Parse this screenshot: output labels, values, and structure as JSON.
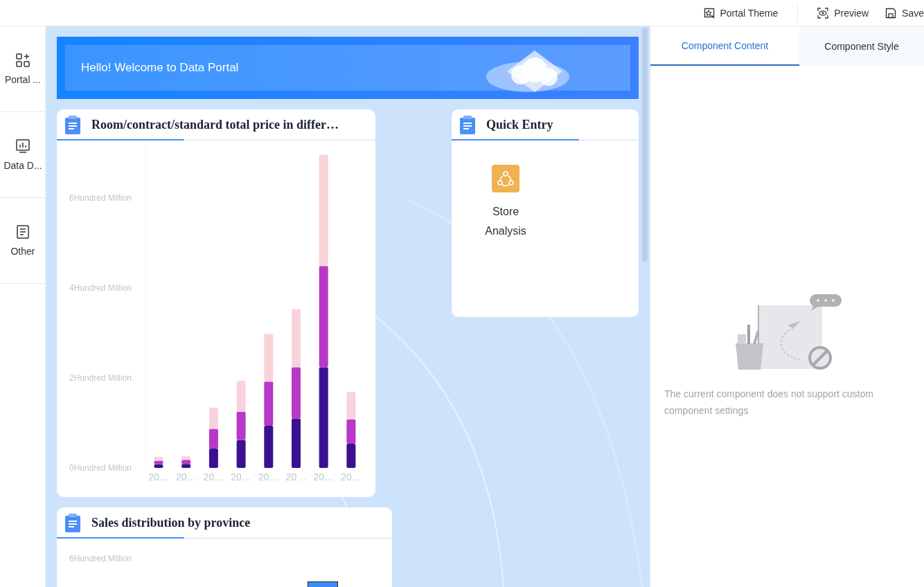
{
  "toolbar": [
    {
      "kind": "theme",
      "label": "Portal Theme",
      "separated": false
    },
    {
      "kind": "preview",
      "label": "Preview",
      "separated": true
    },
    {
      "kind": "save",
      "label": "Save",
      "separated": false
    }
  ],
  "sidebar": {
    "items": [
      {
        "kind": "components",
        "label": "Portal ..."
      },
      {
        "kind": "data",
        "label": "Data D..."
      },
      {
        "kind": "other",
        "label": "Other"
      }
    ]
  },
  "banner": {
    "text": "Hello! Welcome to Data Portal"
  },
  "price_card": {
    "title": "Room/contract/standard total price in differ…",
    "chart_data": {
      "type": "bar",
      "stacked": true,
      "categories": [
        "20…",
        "20…",
        "20…",
        "20…",
        "20…",
        "20…",
        "20…",
        "20…"
      ],
      "ylim": [
        0,
        7.2
      ],
      "yticks": [
        {
          "value": 0,
          "label": "0Hundred Million"
        },
        {
          "value": 2,
          "label": "2Hundred Million"
        },
        {
          "value": 4,
          "label": "4Hundred Million"
        },
        {
          "value": 6,
          "label": "6Hundred Million"
        }
      ],
      "series": [
        {
          "color": "#3b1191",
          "values": [
            0.08,
            0.09,
            0.43,
            0.62,
            0.94,
            1.1,
            2.24,
            0.54
          ]
        },
        {
          "color": "#b838c8",
          "values": [
            0.08,
            0.09,
            0.44,
            0.63,
            0.98,
            1.14,
            2.25,
            0.54
          ]
        },
        {
          "color": "#f9d3da",
          "values": [
            0.09,
            0.08,
            0.47,
            0.69,
            1.06,
            1.29,
            2.47,
            0.61
          ]
        }
      ]
    }
  },
  "quick_entry": {
    "title": "Quick Entry",
    "items": [
      {
        "label": "Store Analysis"
      }
    ]
  },
  "sales_card": {
    "title": "Sales distribution by province",
    "y_tick_label": "6Hundred Million"
  },
  "panel": {
    "tabs": [
      {
        "label": "Component Content",
        "selected": true
      },
      {
        "label": "Component Style",
        "selected": false
      }
    ],
    "message": "The current component does not support custom component settings"
  }
}
